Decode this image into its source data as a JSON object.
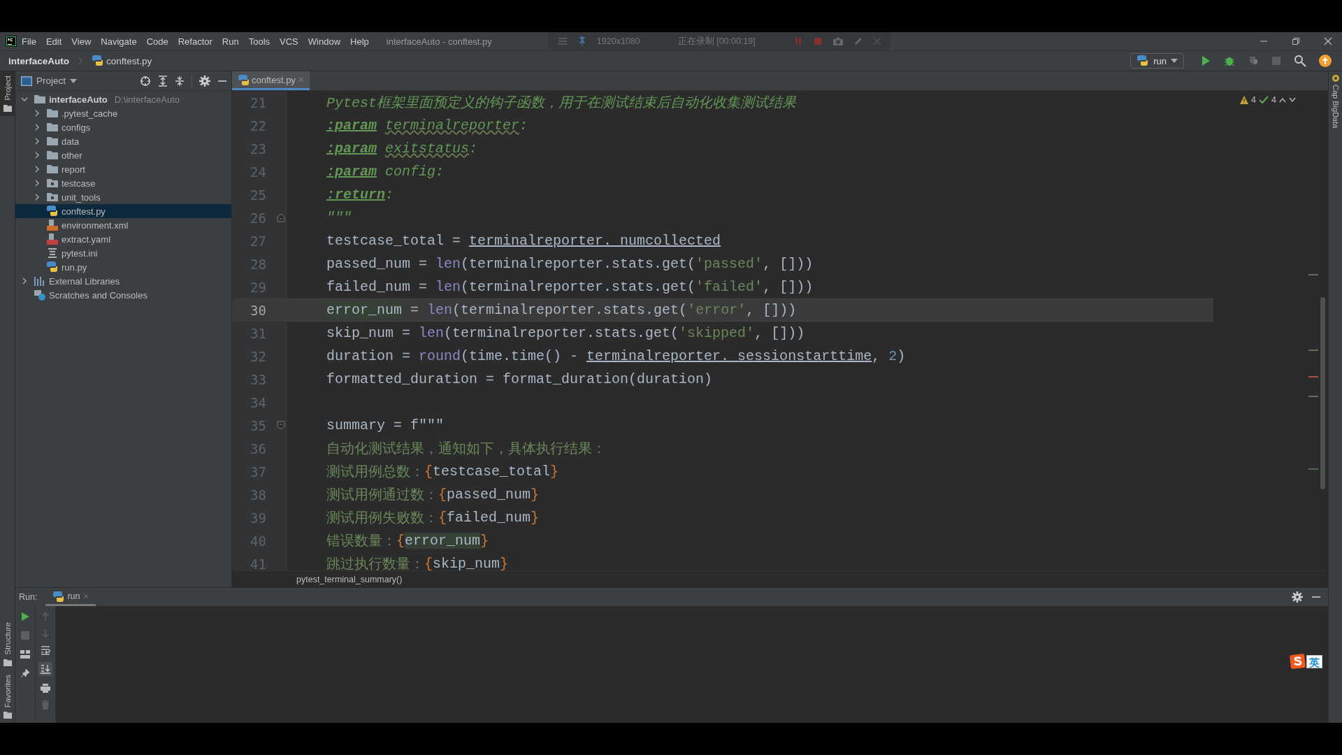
{
  "title_bar": {
    "menus": [
      "File",
      "Edit",
      "View",
      "Navigate",
      "Code",
      "Refactor",
      "Run",
      "Tools",
      "VCS",
      "Window",
      "Help"
    ],
    "title": "interfaceAuto - conftest.py"
  },
  "recorder": {
    "resolution": "1920x1080",
    "status": "正在录制 [00:00:19]"
  },
  "nav_bar": {
    "project": "interfaceAuto",
    "file": "conftest.py",
    "run_config": "run"
  },
  "left_stripe": {
    "top": [
      {
        "label": "Project",
        "selected": true
      }
    ],
    "bottom": [
      {
        "label": "Structure",
        "selected": false
      },
      {
        "label": "Favorites",
        "selected": false
      }
    ]
  },
  "project_panel": {
    "title": "Project",
    "tree": [
      {
        "name": "interfaceAuto",
        "path": "D:\\interfaceAuto",
        "kind": "root",
        "expanded": true,
        "selected": false,
        "children": [
          {
            "name": ".pytest_cache",
            "kind": "folder",
            "expanded": false,
            "selected": false
          },
          {
            "name": "configs",
            "kind": "folder",
            "expanded": false,
            "selected": false
          },
          {
            "name": "data",
            "kind": "folder",
            "expanded": false,
            "selected": false
          },
          {
            "name": "other",
            "kind": "folder",
            "expanded": false,
            "selected": false
          },
          {
            "name": "report",
            "kind": "folder",
            "expanded": false,
            "selected": false
          },
          {
            "name": "testcase",
            "kind": "package",
            "expanded": false,
            "selected": false
          },
          {
            "name": "unit_tools",
            "kind": "package",
            "expanded": false,
            "selected": false
          },
          {
            "name": "conftest.py",
            "kind": "python",
            "selected": true
          },
          {
            "name": "environment.xml",
            "kind": "xml",
            "selected": false
          },
          {
            "name": "extract.yaml",
            "kind": "yaml",
            "selected": false
          },
          {
            "name": "pytest.ini",
            "kind": "ini",
            "selected": false
          },
          {
            "name": "run.py",
            "kind": "python",
            "selected": false
          }
        ]
      },
      {
        "name": "External Libraries",
        "kind": "libraries",
        "expanded": false,
        "selected": false
      },
      {
        "name": "Scratches and Consoles",
        "kind": "scratches",
        "selected": false
      }
    ]
  },
  "editor": {
    "tabs": [
      {
        "label": "conftest.py",
        "selected": true
      }
    ],
    "inspections": {
      "warnings": "4",
      "weak_warnings": "4"
    },
    "lines": [
      {
        "number": "21",
        "current": false,
        "kind": "plain",
        "segments": [
          {
            "text": "Pytest框架里面预定义的钩子函数，用于在测试结束后自动化收集测试结果",
            "kind": "doc"
          }
        ]
      },
      {
        "number": "22",
        "current": false,
        "kind": "plain",
        "segments": [
          {
            "text": ":param",
            "kind": "doc-tag"
          },
          {
            "text": " terminalreporter",
            "kind": "doc-ref"
          },
          {
            "text": ":",
            "kind": "doc"
          }
        ]
      },
      {
        "number": "23",
        "current": false,
        "kind": "plain",
        "segments": [
          {
            "text": ":param",
            "kind": "doc-tag"
          },
          {
            "text": " exitstatus",
            "kind": "doc-ref"
          },
          {
            "text": ":",
            "kind": "doc"
          }
        ]
      },
      {
        "number": "24",
        "current": false,
        "kind": "plain",
        "segments": [
          {
            "text": ":param",
            "kind": "doc-tag"
          },
          {
            "text": " config:",
            "kind": "doc"
          }
        ]
      },
      {
        "number": "25",
        "current": false,
        "kind": "plain",
        "segments": [
          {
            "text": ":return",
            "kind": "doc-tag"
          },
          {
            "text": ":",
            "kind": "doc"
          }
        ]
      },
      {
        "number": "26",
        "current": false,
        "kind": "fold-end",
        "segments": [
          {
            "text": "\"\"\"",
            "kind": "doc"
          }
        ]
      },
      {
        "number": "27",
        "current": false,
        "kind": "plain",
        "segments": [
          {
            "text": "testcase_total = ",
            "kind": "plain"
          },
          {
            "text": "terminalreporter._numcollected",
            "kind": "ref"
          }
        ]
      },
      {
        "number": "28",
        "current": false,
        "kind": "plain",
        "segments": [
          {
            "text": "passed_num = ",
            "kind": "plain"
          },
          {
            "text": "len",
            "kind": "builtin"
          },
          {
            "text": "(terminalreporter.stats.get(",
            "kind": "plain"
          },
          {
            "text": "'passed'",
            "kind": "str"
          },
          {
            "text": ", []))",
            "kind": "plain"
          }
        ]
      },
      {
        "number": "29",
        "current": false,
        "kind": "plain",
        "segments": [
          {
            "text": "failed_num = ",
            "kind": "plain"
          },
          {
            "text": "len",
            "kind": "builtin"
          },
          {
            "text": "(terminalreporter.stats.get(",
            "kind": "plain"
          },
          {
            "text": "'failed'",
            "kind": "str"
          },
          {
            "text": ", []))",
            "kind": "plain"
          }
        ]
      },
      {
        "number": "30",
        "current": true,
        "kind": "plain",
        "segments": [
          {
            "text": "error_num",
            "kind": "hl"
          },
          {
            "text": " = ",
            "kind": "plain"
          },
          {
            "text": "len",
            "kind": "builtin"
          },
          {
            "text": "(terminalreporter.stats.get(",
            "kind": "plain"
          },
          {
            "text": "'error'",
            "kind": "str"
          },
          {
            "text": ", []))",
            "kind": "plain"
          }
        ]
      },
      {
        "number": "31",
        "current": false,
        "kind": "plain",
        "segments": [
          {
            "text": "skip_num = ",
            "kind": "plain"
          },
          {
            "text": "len",
            "kind": "builtin"
          },
          {
            "text": "(terminalreporter.stats.get(",
            "kind": "plain"
          },
          {
            "text": "'skipped'",
            "kind": "str"
          },
          {
            "text": ", []))",
            "kind": "plain"
          }
        ]
      },
      {
        "number": "32",
        "current": false,
        "kind": "plain",
        "segments": [
          {
            "text": "duration = ",
            "kind": "plain"
          },
          {
            "text": "round",
            "kind": "builtin"
          },
          {
            "text": "(time.time() - ",
            "kind": "plain"
          },
          {
            "text": "terminalreporter._sessionstarttime",
            "kind": "ref"
          },
          {
            "text": ", ",
            "kind": "plain"
          },
          {
            "text": "2",
            "kind": "num"
          },
          {
            "text": ")",
            "kind": "plain"
          }
        ]
      },
      {
        "number": "33",
        "current": false,
        "kind": "plain",
        "segments": [
          {
            "text": "formatted_duration = format_duration(duration)",
            "kind": "plain"
          }
        ]
      },
      {
        "number": "34",
        "current": false,
        "kind": "plain"
      },
      {
        "number": "35",
        "current": false,
        "kind": "fold-start",
        "segments": [
          {
            "text": "summary = f\"\"\"",
            "kind": "plain"
          }
        ]
      },
      {
        "number": "36",
        "current": false,
        "kind": "plain",
        "segments": [
          {
            "text": "自动化测试结果，通知如下，具体执行结果：",
            "kind": "str"
          }
        ]
      },
      {
        "number": "37",
        "current": false,
        "kind": "plain",
        "segments": [
          {
            "text": "测试用例总数：",
            "kind": "str"
          },
          {
            "text": "{",
            "kind": "brace"
          },
          {
            "text": "testcase_total",
            "kind": "plain"
          },
          {
            "text": "}",
            "kind": "brace"
          }
        ]
      },
      {
        "number": "38",
        "current": false,
        "kind": "plain",
        "segments": [
          {
            "text": "测试用例通过数：",
            "kind": "str"
          },
          {
            "text": "{",
            "kind": "brace"
          },
          {
            "text": "passed_num",
            "kind": "plain"
          },
          {
            "text": "}",
            "kind": "brace"
          }
        ]
      },
      {
        "number": "39",
        "current": false,
        "kind": "plain",
        "segments": [
          {
            "text": "测试用例失败数：",
            "kind": "str"
          },
          {
            "text": "{",
            "kind": "brace"
          },
          {
            "text": "failed_num",
            "kind": "plain"
          },
          {
            "text": "}",
            "kind": "brace"
          }
        ]
      },
      {
        "number": "40",
        "current": false,
        "kind": "plain",
        "segments": [
          {
            "text": "错误数量：",
            "kind": "str"
          },
          {
            "text": "{",
            "kind": "brace"
          },
          {
            "text": "error_num",
            "kind": "hl"
          },
          {
            "text": "}",
            "kind": "brace"
          }
        ]
      },
      {
        "number": "41",
        "current": false,
        "kind": "plain",
        "segments": [
          {
            "text": "跳过执行数量：",
            "kind": "str"
          },
          {
            "text": "{",
            "kind": "brace"
          },
          {
            "text": "skip_num",
            "kind": "plain"
          },
          {
            "text": "}",
            "kind": "brace"
          }
        ]
      }
    ],
    "breadcrumb": "pytest_terminal_summary()"
  },
  "right_stripe": {
    "label": "Cap BigData"
  },
  "run_panel": {
    "label": "Run:",
    "tabs": [
      {
        "label": "run",
        "selected": true
      }
    ]
  },
  "ime_badge": {
    "mode": "英"
  }
}
